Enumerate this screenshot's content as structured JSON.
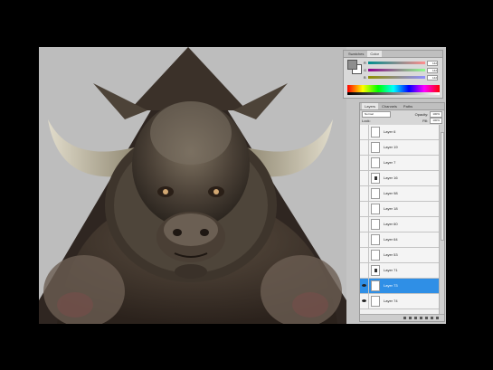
{
  "color_panel": {
    "tabs": [
      "Swatches",
      "Color"
    ],
    "active_tab": "Color",
    "sliders": [
      {
        "label": "R",
        "value": "142"
      },
      {
        "label": "G",
        "value": "142"
      },
      {
        "label": "B",
        "value": "142"
      }
    ]
  },
  "layers_panel": {
    "tabs": [
      "Layers",
      "Channels",
      "Paths"
    ],
    "active_tab": "Layers",
    "blend_mode": "Normal",
    "opacity_label": "Opacity:",
    "opacity_value": "100%",
    "lock_label": "Lock:",
    "fill_label": "Fill:",
    "fill_value": "100%",
    "layers": [
      {
        "name": "Layer 6",
        "visible": false,
        "selected": false
      },
      {
        "name": "Layer 19",
        "visible": false,
        "selected": false
      },
      {
        "name": "Layer 7",
        "visible": false,
        "selected": false
      },
      {
        "name": "Layer 16",
        "visible": false,
        "selected": false
      },
      {
        "name": "Layer 98",
        "visible": false,
        "selected": false
      },
      {
        "name": "Layer 18",
        "visible": false,
        "selected": false
      },
      {
        "name": "Layer 60",
        "visible": false,
        "selected": false
      },
      {
        "name": "Layer 64",
        "visible": false,
        "selected": false
      },
      {
        "name": "Layer 53",
        "visible": false,
        "selected": false
      },
      {
        "name": "Layer 71",
        "visible": false,
        "selected": false
      },
      {
        "name": "Layer 73",
        "visible": true,
        "selected": true
      },
      {
        "name": "Layer 74",
        "visible": true,
        "selected": false
      }
    ]
  }
}
